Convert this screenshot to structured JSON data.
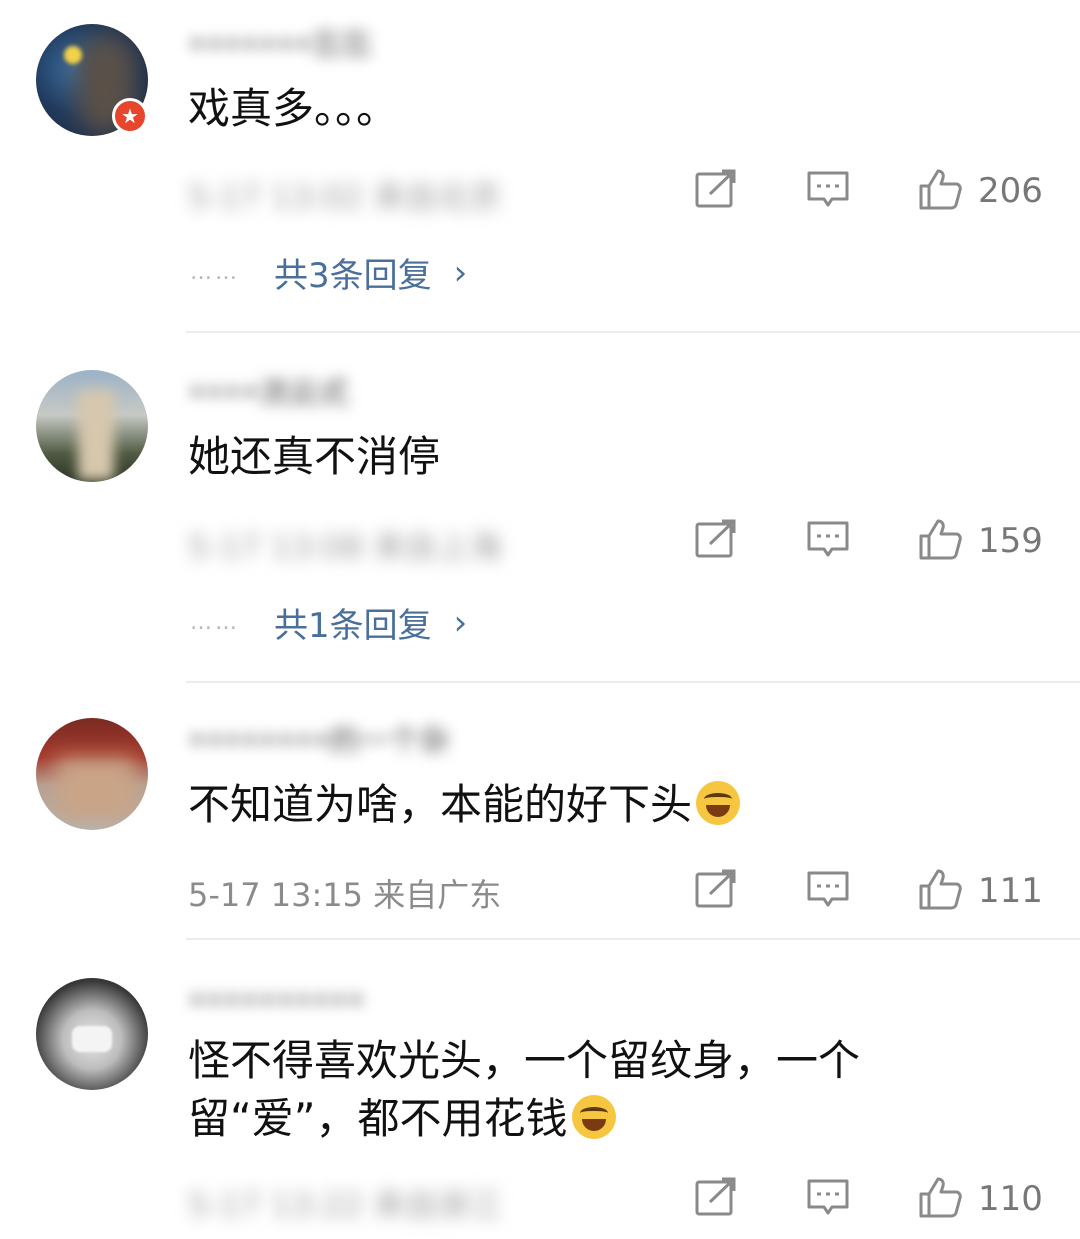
{
  "comments": [
    {
      "username": "•••••••忘忘",
      "text": "戏真多。。。",
      "meta": "5-17 13:02 来自北京",
      "meta_blurred": true,
      "likes": "206",
      "replies_dots": "……",
      "replies_text": "共3条回复",
      "has_badge": true,
      "badge_icon": "★"
    },
    {
      "username": "••••流云式",
      "text": "她还真不消停",
      "meta": "5-17 13:08 来自上海",
      "meta_blurred": true,
      "likes": "159",
      "replies_dots": "……",
      "replies_text": "共1条回复"
    },
    {
      "username": "••••••••的一个杂",
      "text": "不知道为啥，本能的好下头",
      "meta": "5-17 13:15 来自广东",
      "meta_blurred": false,
      "likes": "111"
    },
    {
      "username": "••••••••••",
      "text": "怪不得喜欢光头，一个留纹身，一个留“爱”，都不用花钱",
      "meta": "5-17 13:22 来自浙江",
      "meta_blurred": true,
      "likes": "110"
    }
  ],
  "icons": {
    "repost": "repost-icon",
    "comment": "comment-icon",
    "like": "thumbs-up-icon",
    "chevron": "›",
    "emoji": "laughing-tears-emoji"
  },
  "colors": {
    "reply_link": "#4a6f9a",
    "meta": "#8b8b8b",
    "divider": "#ececec",
    "badge": "#e8452d"
  }
}
